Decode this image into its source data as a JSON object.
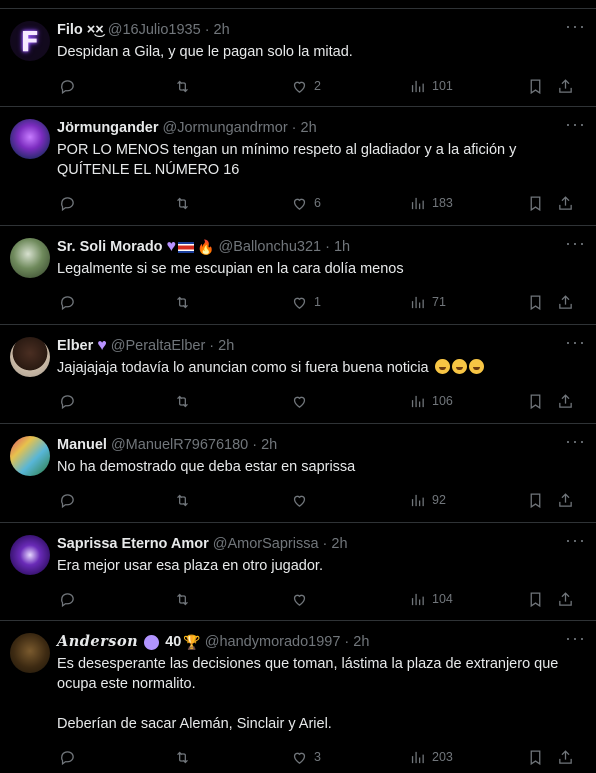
{
  "tweets": [
    {
      "name": "Filo ×͜×",
      "handle": "@16Julio1935",
      "time": "2h",
      "text": "Despidan a Gila, y que le pagan solo la mitad.",
      "likes": "2",
      "views": "101",
      "avatar_letter": "F"
    },
    {
      "name": "Jörmungander",
      "handle": "@Jormungandrmor",
      "time": "2h",
      "text": "POR LO MENOS tengan un mínimo respeto al gladiador y a la afición y QUÍTENLE EL NÚMERO 16",
      "likes": "6",
      "views": "183"
    },
    {
      "name": "Sr. Soli Morado",
      "handle": "@Ballonchu321",
      "time": "1h",
      "text": "Legalmente si se me escupian en la cara dolía menos",
      "likes": "1",
      "views": "71"
    },
    {
      "name": "Elber",
      "handle": "@PeraltaElber",
      "time": "2h",
      "text": "Jajajajaja todavía lo anuncian como si fuera buena noticia",
      "likes": "",
      "views": "106"
    },
    {
      "name": "Manuel",
      "handle": "@ManuelR79676180",
      "time": "2h",
      "text": "No ha demostrado que deba estar en saprissa",
      "likes": "",
      "views": "92"
    },
    {
      "name": "Saprissa Eterno Amor",
      "handle": "@AmorSaprissa",
      "time": "2h",
      "text": "Era mejor usar esa plaza en otro jugador.",
      "likes": "",
      "views": "104"
    },
    {
      "name": "Anderson",
      "name_suffix": "40",
      "handle": "@handymorado1997",
      "time": "2h",
      "text": "Es desesperante las decisiones que toman, lástima la plaza de extranjero que ocupa este normalito.\n\nDeberían de sacar Alemán, Sinclair y Ariel.",
      "likes": "3",
      "views": "203"
    }
  ],
  "separator": "·",
  "more_glyph": "···",
  "icons": [
    "reply-icon",
    "retweet-icon",
    "like-icon",
    "views-icon",
    "bookmark-icon",
    "share-icon"
  ],
  "colors": {
    "background": "#000000",
    "text": "#e7e9ea",
    "muted": "#71767b",
    "border": "#2f3336"
  }
}
